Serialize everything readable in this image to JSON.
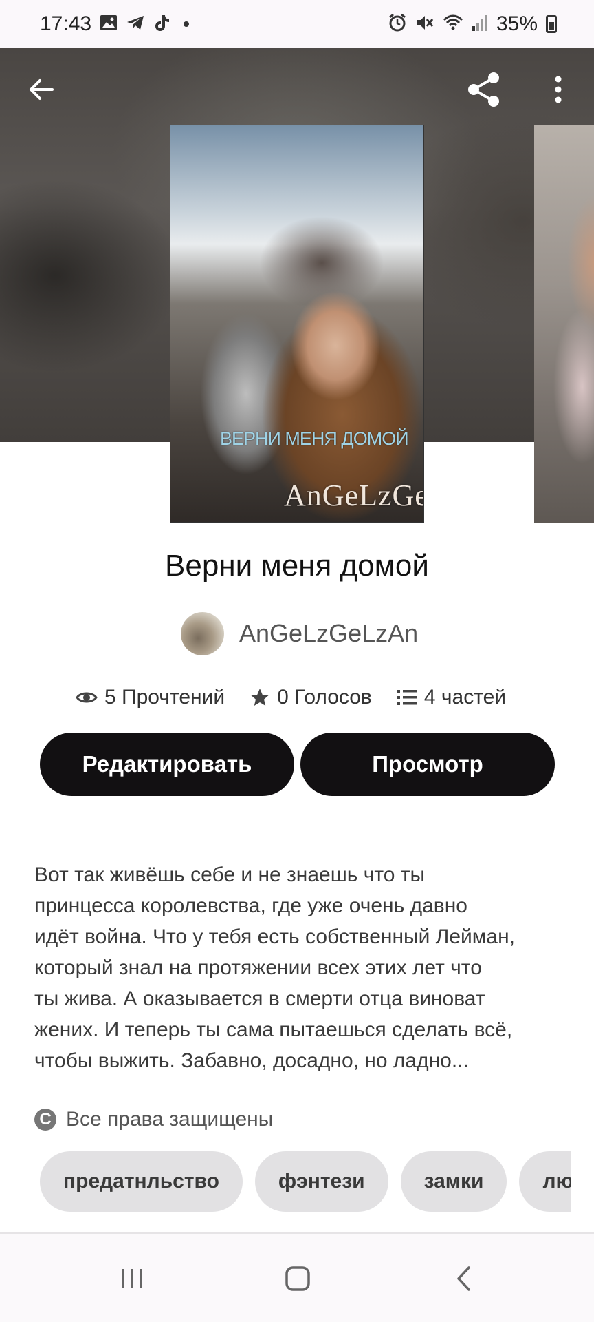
{
  "status_bar": {
    "time": "17:43",
    "battery": "35%",
    "left_icons": [
      "gallery-icon",
      "telegram-icon",
      "tiktok-icon",
      "dot-icon"
    ],
    "right_icons": [
      "alarm-icon",
      "mute-icon",
      "wifi-icon",
      "signal-icon",
      "battery-icon"
    ]
  },
  "toolbar": {
    "back_icon": "arrow-left-icon",
    "share_icon": "share-icon",
    "more_icon": "more-vertical-icon"
  },
  "cover": {
    "title_text": "ВЕРНИ МЕНЯ ДОМОЙ",
    "author_text": "AnGeLzGeLzAn"
  },
  "story": {
    "title": "Верни меня домой",
    "author": "AnGeLzGeLzAn",
    "stats": {
      "reads": "5 Прочтений",
      "votes": "0 Голосов",
      "parts": "4 частей"
    },
    "edit_label": "Редактировать",
    "view_label": "Просмотр",
    "description": "Вот так живёшь себе и не знаешь что ты\nпринцесса королевства, где уже очень давно\nидёт война. Что у тебя есть собственный Лейман,\nкоторый знал на протяжении всех этих лет что\nты жива. А оказывается в смерти отца виноват\nжених. И теперь ты сама пытаешься сделать всё,\nчтобы выжить. Забавно, досадно,  но ладно...",
    "copyright": "Все права защищены",
    "tags": [
      "предатнльство",
      "фэнтези",
      "замки",
      "любовь"
    ]
  },
  "colors": {
    "button_bg": "#121012",
    "tag_bg": "#e2e1e3",
    "hero_bg": "#4a4643"
  }
}
